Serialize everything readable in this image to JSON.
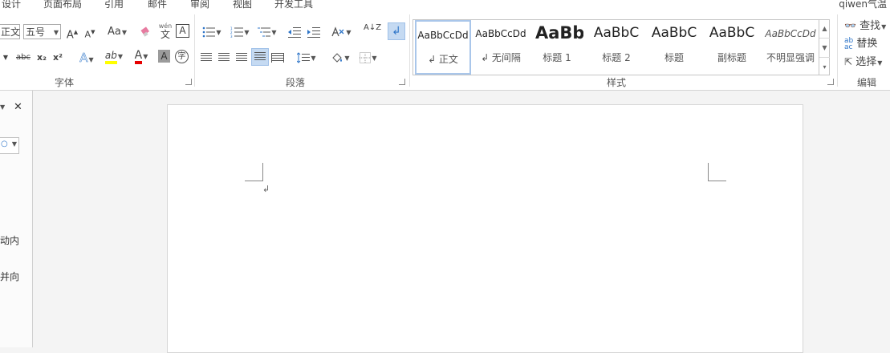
{
  "tabs": [
    "设计",
    "页面布局",
    "引用",
    "邮件",
    "审阅",
    "视图",
    "开发工具"
  ],
  "account": "qiwen气温",
  "font": {
    "label": "字体",
    "name_value": "正文",
    "size_value": "五号",
    "grow_icon": "A",
    "shrink_icon": "A",
    "case_label": "Aa",
    "phonetic_top": "wén",
    "phonetic_bottom": "文",
    "border_char": "A",
    "strike_label": "abc",
    "sub_label": "x₂",
    "sup_label": "x²",
    "effect_label": "A",
    "highlight_label": "ab",
    "color_label": "A",
    "shade_label": "A",
    "enclose_label": "字",
    "highlight_color": "#ffff00",
    "font_color": "#e60000"
  },
  "paragraph": {
    "label": "段落",
    "sort_label": "A↓Z"
  },
  "styles": {
    "label": "样式",
    "items": [
      {
        "sample": "AaBbCcDd",
        "name": "↲ 正文"
      },
      {
        "sample": "AaBbCcDd",
        "name": "↲ 无间隔"
      },
      {
        "sample": "AaBb",
        "name": "标题 1"
      },
      {
        "sample": "AaBbC",
        "name": "标题 2"
      },
      {
        "sample": "AaBbC",
        "name": "标题"
      },
      {
        "sample": "AaBbC",
        "name": "副标题"
      },
      {
        "sample": "AaBbCcDd",
        "name": "不明显强调"
      }
    ]
  },
  "editing": {
    "label": "编辑",
    "find": "查找",
    "replace": "替换",
    "select": "选择"
  },
  "nav_pane": {
    "close": "✕",
    "line1": "动内",
    "line2": "并向"
  },
  "document": {
    "para_mark": "↲"
  }
}
